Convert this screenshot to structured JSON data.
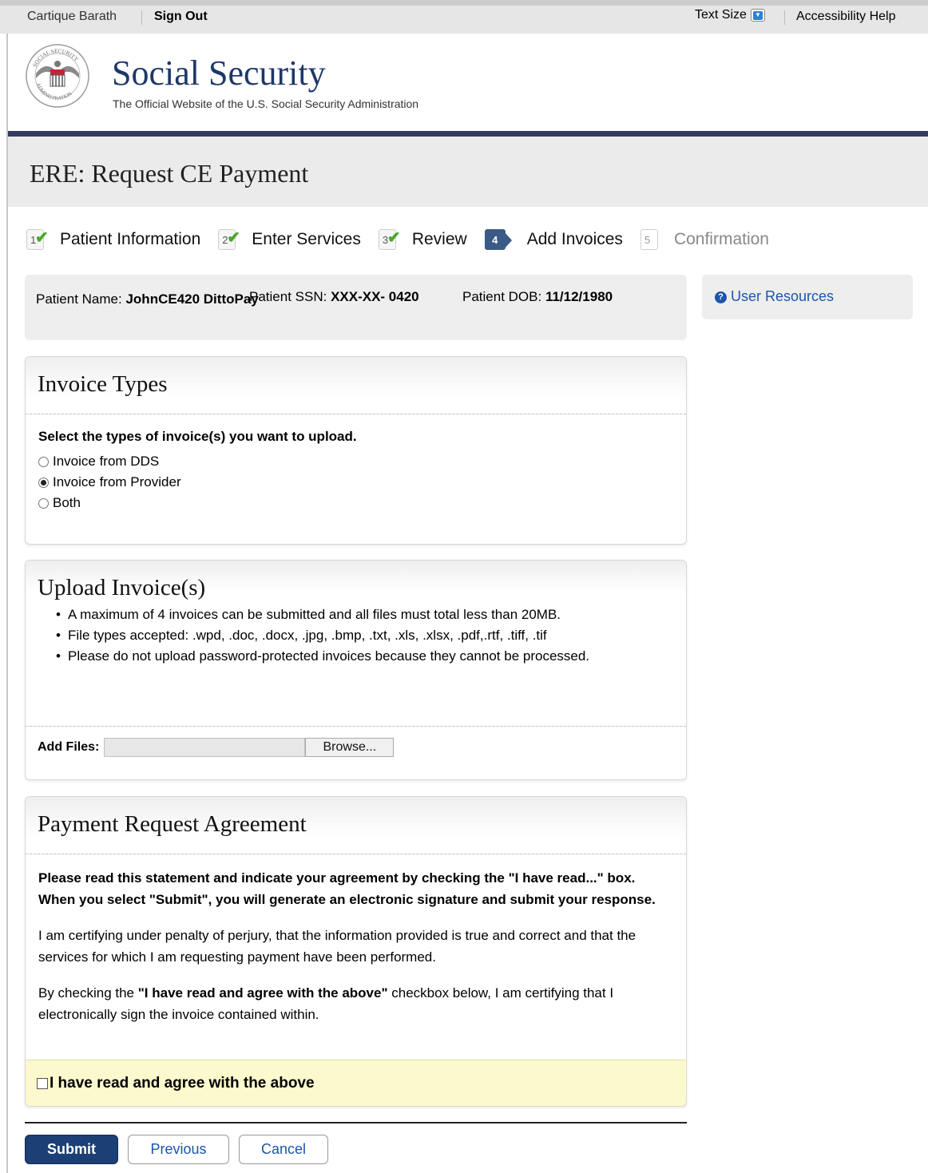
{
  "topbar": {
    "user_name": "Cartique Barath",
    "sign_out": "Sign Out",
    "text_size": "Text Size",
    "accessibility_help": "Accessibility Help"
  },
  "header": {
    "brand": "Social Security",
    "tagline": "The Official Website of the U.S. Social Security Administration",
    "seal_text": "SOCIAL SECURITY ADMINISTRATION USA"
  },
  "page": {
    "title": "ERE: Request CE Payment"
  },
  "steps": [
    {
      "number": "1",
      "label": "Patient Information",
      "status": "complete"
    },
    {
      "number": "2",
      "label": "Enter Services",
      "status": "complete"
    },
    {
      "number": "3",
      "label": "Review",
      "status": "complete"
    },
    {
      "number": "4",
      "label": "Add Invoices",
      "status": "current"
    },
    {
      "number": "5",
      "label": "Confirmation",
      "status": "future"
    }
  ],
  "patient": {
    "name_label": "Patient Name:",
    "name_value": "JohnCE420 DittoPay",
    "ssn_label": "Patient SSN:",
    "ssn_value": "XXX-XX- 0420",
    "dob_label": "Patient DOB:",
    "dob_value": "11/12/1980"
  },
  "resources": {
    "icon": "question-circle-icon",
    "label": "User Resources"
  },
  "invoice_types": {
    "title": "Invoice Types",
    "question": "Select the types of invoice(s) you want to upload.",
    "options": [
      {
        "label": "Invoice from DDS",
        "selected": false
      },
      {
        "label": "Invoice from Provider",
        "selected": true
      },
      {
        "label": "Both",
        "selected": false
      }
    ]
  },
  "upload": {
    "title": "Upload Invoice(s)",
    "bullets": [
      "A maximum of 4 invoices can be submitted and all files must total less than 20MB.",
      "File types accepted: .wpd, .doc, .docx, .jpg, .bmp, .txt, .xls, .xlsx, .pdf,.rtf, .tiff, .tif",
      "Please do not upload password-protected invoices because they cannot be processed."
    ],
    "add_files_label": "Add Files:",
    "browse_label": "Browse...",
    "file_value": ""
  },
  "agreement": {
    "title": "Payment Request Agreement",
    "intro": "Please read this statement and indicate your agreement by checking the \"I have read...\" box. When you select \"Submit\", you will generate an electronic signature and submit your response.",
    "certify": "I am certifying under penalty of perjury, that the information provided is true and correct and that the services for which I am requesting payment have been performed.",
    "sign_prefix": "By checking the ",
    "sign_bold": "\"I have read and agree with the above\"",
    "sign_suffix": " checkbox below, I am certifying that I electronically sign the invoice contained within.",
    "checkbox_label": "I have read and agree with the above",
    "checked": false
  },
  "buttons": {
    "submit": "Submit",
    "previous": "Previous",
    "cancel": "Cancel"
  },
  "colors": {
    "brand_navy": "#1d3868",
    "header_rule": "#333c5c",
    "link_blue": "#1e55a8",
    "check_green": "#4aa72c",
    "agree_bg": "#fbf9cd"
  }
}
